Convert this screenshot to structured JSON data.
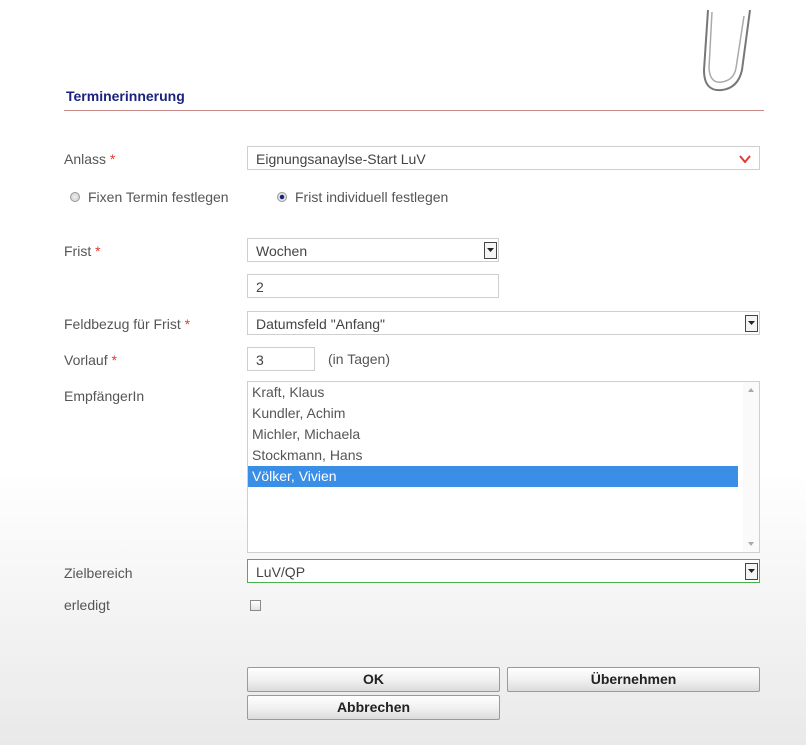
{
  "dialog": {
    "title": "Terminerinnerung"
  },
  "form": {
    "anlass": {
      "label": "Anlass",
      "required": "*",
      "value": "Eignungsanaylse-Start LuV"
    },
    "radio_fixed": {
      "label": "Fixen Termin festlegen",
      "checked": false
    },
    "radio_individual": {
      "label": "Frist individuell festlegen",
      "checked": true
    },
    "frist": {
      "label": "Frist",
      "required": "*",
      "unit_value": "Wochen",
      "amount": "2"
    },
    "feldbezug": {
      "label": "Feldbezug für Frist",
      "required": "*",
      "value": "Datumsfeld \"Anfang\""
    },
    "vorlauf": {
      "label": "Vorlauf",
      "required": "*",
      "value": "3",
      "suffix": "(in Tagen)"
    },
    "empfaenger": {
      "label": "EmpfängerIn",
      "items": [
        "Kraft, Klaus",
        "Kundler, Achim",
        "Michler, Michaela",
        "Stockmann, Hans",
        "Völker, Vivien"
      ],
      "selected": "Völker, Vivien"
    },
    "zielbereich": {
      "label": "Zielbereich",
      "value": "LuV/QP"
    },
    "erledigt": {
      "label": "erledigt",
      "checked": false
    }
  },
  "buttons": {
    "ok": "OK",
    "apply": "Übernehmen",
    "cancel": "Abbrechen"
  },
  "colors": {
    "title": "#1a237e",
    "required": "#e53935",
    "selection": "#3a8ee6",
    "focus_border": "#4caf50",
    "dropdown_arrow": "#e53935"
  }
}
